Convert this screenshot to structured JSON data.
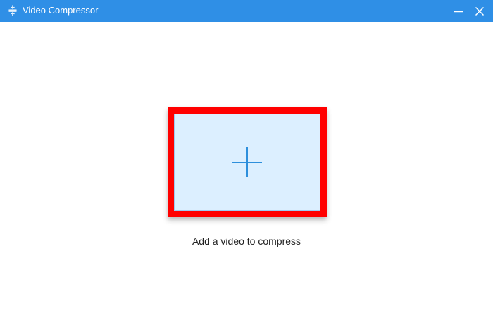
{
  "window": {
    "title": "Video Compressor",
    "app_icon": "compress-icon",
    "minimize_icon": "minimize-icon",
    "close_icon": "close-icon"
  },
  "main": {
    "drop_icon": "plus-icon",
    "hint": "Add a video to compress"
  },
  "colors": {
    "titlebar": "#2f8fe6",
    "drop_zone": "#dcefff",
    "plus": "#2d8fdc",
    "highlight": "#ff0000"
  }
}
